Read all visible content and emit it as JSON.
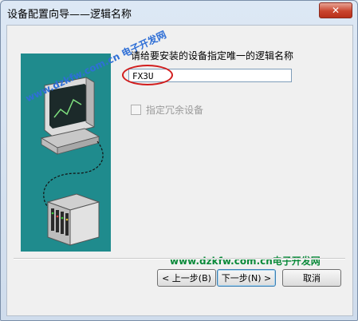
{
  "window": {
    "title": "设备配置向导——逻辑名称"
  },
  "titlebar": {
    "close_glyph": "✕"
  },
  "main": {
    "prompt": "请给要安装的设备指定唯一的逻辑名称",
    "logical_name": "FX3U",
    "redundant_checkbox": {
      "label": "指定冗余设备",
      "checked": false,
      "enabled": false
    }
  },
  "watermarks": {
    "diagonal": "www.dzkfw.com.cn 电子开发网",
    "bottom": "www.dzkfw.com.cn电子开发网"
  },
  "buttons": {
    "back": "< 上一步(B)",
    "next": "下一步(N) >",
    "cancel": "取消"
  },
  "colors": {
    "art_background": "#1f8b8d",
    "highlight_circle": "#d21d1d",
    "watermark_blue": "#2f6fd6",
    "watermark_green": "#0a8a3a"
  },
  "icons": [
    "computer-monitor-icon",
    "plc-rack-icon",
    "close-icon"
  ]
}
